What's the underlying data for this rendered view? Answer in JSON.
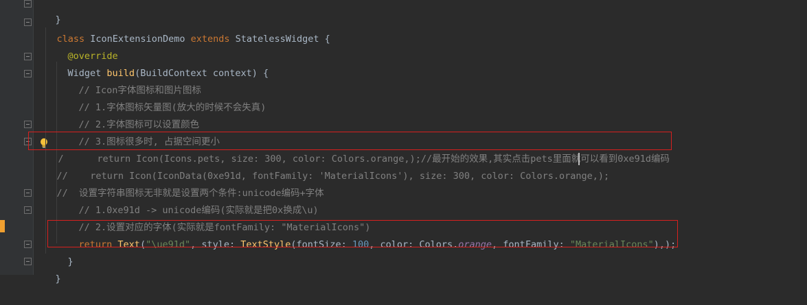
{
  "lines": {
    "l0": "}",
    "l1a": "class",
    "l1b": " IconExtensionDemo ",
    "l1c": "extends",
    "l1d": " StatelessWidget {",
    "l2": "@override",
    "l3a": "Widget ",
    "l3b": "build",
    "l3c": "(BuildContext context) {",
    "l4": "// Icon字体图标和图片图标",
    "l5": "// 1.字体图标矢量图(放大的时候不会失真)",
    "l6": "// 2.字体图标可以设置颜色",
    "l7": "// 3.图标很多时, 占据空间更小",
    "l8": "/      return Icon(Icons.pets, size: 300, color: Colors.orange,);//最开始的效果,其实点击pets里面就可以看到0xe91d编码",
    "l9": "//    return Icon(IconData(0xe91d, fontFamily: 'MaterialIcons'), size: 300, color: Colors.orange,);",
    "l10": "//  设置字符串图标无非就是设置两个条件:unicode编码+字体",
    "l11": "// 1.0xe91d -> unicode编码(实际就是把0x换成\\u)",
    "l12": "// 2.设置对应的字体(实际就是fontFamily: \"MaterialIcons\")",
    "l13a": "return",
    "l13b": " Text",
    "l13c": "(",
    "l13d": "\"\\ue91d\"",
    "l13e": ", style: ",
    "l13f": "TextStyle",
    "l13g": "(fontSize: ",
    "l13h": "100",
    "l13i": ", color: Colors.",
    "l13j": "orange",
    "l13k": ", fontFamily: ",
    "l13l": "\"MaterialIcons\"",
    "l13m": "),);",
    "l14": "}",
    "l15": "}"
  },
  "colors": {
    "background": "#2b2b2b",
    "keyword": "#cc7832",
    "annotation": "#bbb529",
    "function": "#ffc66d",
    "comment": "#808080",
    "string": "#6a8759",
    "number": "#6897bb",
    "highlight_box": "#d9201e",
    "change_marker": "#f0a030"
  },
  "icons": {
    "intention": "lightbulb-icon",
    "fold": "fold-icon"
  }
}
